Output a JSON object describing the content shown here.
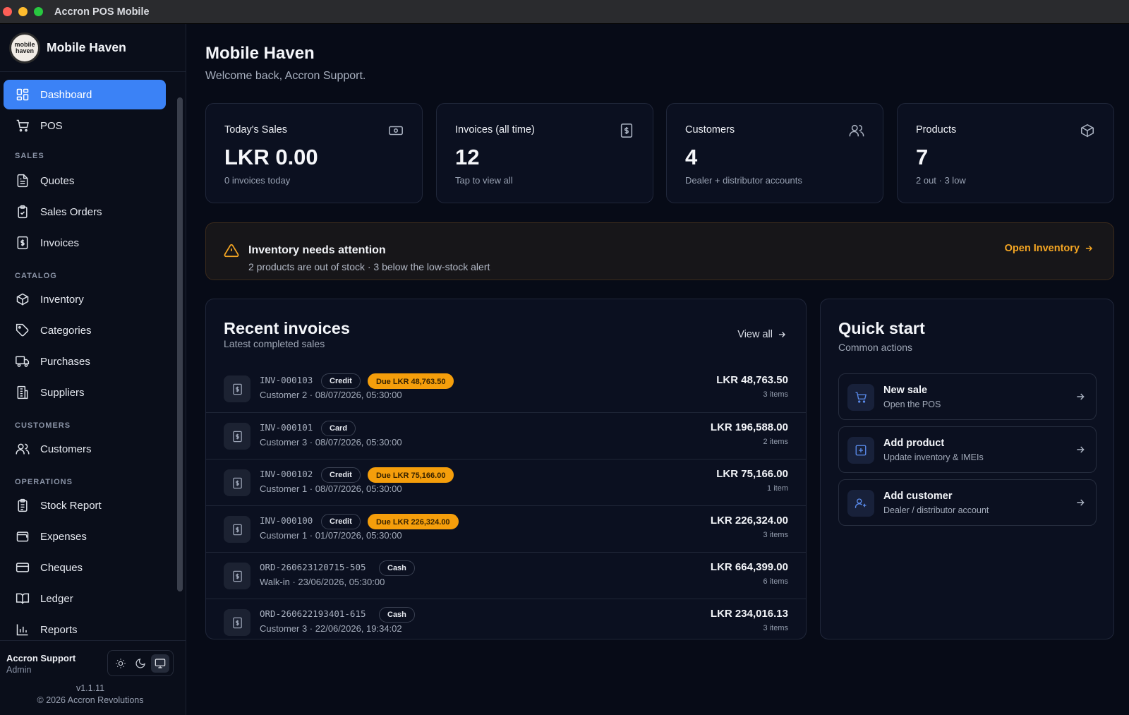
{
  "window": {
    "title": "Accron POS Mobile"
  },
  "brand": {
    "name": "Mobile Haven",
    "logo_text": "mobile haven"
  },
  "sidebar": {
    "items": [
      {
        "label": "Dashboard"
      },
      {
        "label": "POS"
      },
      {
        "label": "Quotes"
      },
      {
        "label": "Sales Orders"
      },
      {
        "label": "Invoices"
      },
      {
        "label": "Inventory"
      },
      {
        "label": "Categories"
      },
      {
        "label": "Purchases"
      },
      {
        "label": "Suppliers"
      },
      {
        "label": "Customers"
      },
      {
        "label": "Stock Report"
      },
      {
        "label": "Expenses"
      },
      {
        "label": "Cheques"
      },
      {
        "label": "Ledger"
      },
      {
        "label": "Reports"
      }
    ],
    "sections": {
      "sales": "SALES",
      "catalog": "CATALOG",
      "customers": "CUSTOMERS",
      "operations": "OPERATIONS"
    },
    "footer": {
      "user_name": "Accron Support",
      "user_role": "Admin",
      "version": "v1.1.11",
      "copyright": "© 2026 Accron Revolutions"
    }
  },
  "header": {
    "title": "Mobile Haven",
    "subtitle": "Welcome back, Accron Support."
  },
  "stats": [
    {
      "label": "Today's Sales",
      "value": "LKR 0.00",
      "sub": "0 invoices today",
      "icon": "cash-icon"
    },
    {
      "label": "Invoices (all time)",
      "value": "12",
      "sub": "Tap to view all",
      "icon": "receipt-icon"
    },
    {
      "label": "Customers",
      "value": "4",
      "sub": "Dealer + distributor accounts",
      "icon": "users-icon"
    },
    {
      "label": "Products",
      "value": "7",
      "sub": "2 out · 3 low",
      "icon": "box-icon"
    }
  ],
  "alert": {
    "title": "Inventory needs attention",
    "subtitle": "2 products are out of stock · 3 below the low-stock alert",
    "link": "Open Inventory",
    "color": "#f5a623"
  },
  "recent": {
    "title": "Recent invoices",
    "subtitle": "Latest completed sales",
    "view_all": "View all",
    "rows": [
      {
        "id": "INV-000103",
        "method": "Credit",
        "due": "Due LKR 48,763.50",
        "meta": "Customer 2 · 08/07/2026, 05:30:00",
        "amount": "LKR 48,763.50",
        "items": "3 items"
      },
      {
        "id": "INV-000101",
        "method": "Card",
        "due": "",
        "meta": "Customer 3 · 08/07/2026, 05:30:00",
        "amount": "LKR 196,588.00",
        "items": "2 items"
      },
      {
        "id": "INV-000102",
        "method": "Credit",
        "due": "Due LKR 75,166.00",
        "meta": "Customer 1 · 08/07/2026, 05:30:00",
        "amount": "LKR 75,166.00",
        "items": "1 item"
      },
      {
        "id": "INV-000100",
        "method": "Credit",
        "due": "Due LKR 226,324.00",
        "meta": "Customer 1 · 01/07/2026, 05:30:00",
        "amount": "LKR 226,324.00",
        "items": "3 items"
      },
      {
        "id": "ORD-260623120715-505",
        "method": "Cash",
        "due": "",
        "meta": "Walk-in · 23/06/2026, 05:30:00",
        "amount": "LKR 664,399.00",
        "items": "6 items"
      },
      {
        "id": "ORD-260622193401-615",
        "method": "Cash",
        "due": "",
        "meta": "Customer 3 · 22/06/2026, 19:34:02",
        "amount": "LKR 234,016.13",
        "items": "3 items"
      }
    ]
  },
  "quick": {
    "title": "Quick start",
    "subtitle": "Common actions",
    "actions": [
      {
        "title": "New sale",
        "sub": "Open the POS",
        "icon": "cart-icon"
      },
      {
        "title": "Add product",
        "sub": "Update inventory & IMEIs",
        "icon": "plus-square-icon"
      },
      {
        "title": "Add customer",
        "sub": "Dealer / distributor account",
        "icon": "user-plus-icon"
      }
    ]
  },
  "colors": {
    "accent": "#3b82f6",
    "due_badge": "#f59e0b",
    "background": "#070b17"
  }
}
